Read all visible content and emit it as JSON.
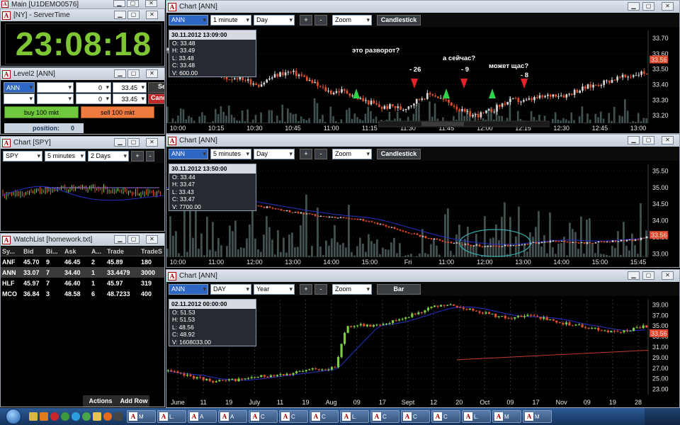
{
  "main": {
    "title": "Main [U1DEMO0576]"
  },
  "server_time": {
    "title": "[NY] - ServerTime",
    "time": "23:08:18"
  },
  "level2": {
    "title": "Level2 [ANN]",
    "symbol": "ANN",
    "row1": {
      "qty": "0",
      "price": "33.45",
      "side_btn": "Se"
    },
    "row2": {
      "qty": "0",
      "price": "33.45",
      "side_btn": "Canc"
    },
    "buy_label": "buy 100 mkt",
    "sell_label": "sell 100 mkt",
    "position_label": "position:",
    "position_value": "0"
  },
  "spy_chart": {
    "title": "Chart [SPY]",
    "symbol": "SPY",
    "interval": "5 minutes",
    "range": "2 Days",
    "plus": "+",
    "minus": "-"
  },
  "watchlist": {
    "title": "WatchList [homework.txt]",
    "columns": [
      "Sy...",
      "Bid",
      "Bi...",
      "Ask",
      "A...",
      "Trade",
      "TradeS"
    ],
    "rows": [
      [
        "ANF",
        "45.70",
        "9",
        "46.45",
        "2",
        "45.89",
        "180"
      ],
      [
        "ANN",
        "33.07",
        "7",
        "34.40",
        "1",
        "33.4479",
        "3000"
      ],
      [
        "HLF",
        "45.97",
        "7",
        "46.40",
        "1",
        "45.97",
        "319"
      ],
      [
        "MCO",
        "36.84",
        "3",
        "48.58",
        "6",
        "48.7233",
        "400"
      ]
    ],
    "actions_label": "Actions",
    "add_row_label": "Add Row"
  },
  "chart1": {
    "title": "Chart [ANN]",
    "symbol": "ANN",
    "interval": "1 minute",
    "range": "Day",
    "zoom": "Zoom",
    "style": "Candlestick",
    "plus": "+",
    "minus": "-",
    "ohlc": {
      "date": "30.11.2012 13:09:00",
      "o": "O: 33.48",
      "h": "H: 33.49",
      "l": "L: 33.48",
      "c": "C: 33.48",
      "v": "V: 600.00"
    },
    "last_price": "33.56",
    "annotations": [
      "это разворот?",
      "а сейчас?",
      "может щас?",
      "- 26",
      "- 9",
      "- 8"
    ]
  },
  "chart2": {
    "title": "Chart [ANN]",
    "symbol": "ANN",
    "interval": "5 minutes",
    "range": "Day",
    "zoom": "Zoom",
    "style": "Candlestick",
    "plus": "+",
    "minus": "-",
    "ohlc": {
      "date": "30.11.2012 13:50:00",
      "o": "O: 33.44",
      "h": "H: 33.47",
      "l": "L: 33.43",
      "c": "C: 33.47",
      "v": "V: 7700.00"
    },
    "last_price": "33.56"
  },
  "chart3": {
    "title": "Chart [ANN]",
    "symbol": "ANN",
    "interval": "DAY",
    "range": "Year",
    "zoom": "Zoom",
    "style": "Bar",
    "plus": "+",
    "minus": "-",
    "ohlc": {
      "date": "02.11.2012 00:00:00",
      "o": "O: 51.53",
      "h": "H: 51.53",
      "l": "L: 48.56",
      "c": "C: 48.92",
      "v": "V: 1608033.00"
    },
    "last_price": "33.56"
  },
  "chart_data": [
    {
      "type": "candlestick",
      "symbol": "ANN",
      "interval": "1 minute",
      "x_ticks": [
        "10:00",
        "10:15",
        "10:30",
        "10:45",
        "11:00",
        "11:15",
        "11:30",
        "11:45",
        "12:00",
        "12:15",
        "12:30",
        "12:45",
        "13:00"
      ],
      "y_ticks": [
        "33.70",
        "33.60",
        "33.50",
        "33.40",
        "33.30",
        "33.20"
      ],
      "ylim": [
        33.15,
        33.75
      ],
      "close": [
        33.62,
        33.58,
        33.55,
        33.52,
        33.5,
        33.46,
        33.44,
        33.45,
        33.42,
        33.4,
        33.44,
        33.47,
        33.48,
        33.46,
        33.42,
        33.38,
        33.35,
        33.36,
        33.34,
        33.3,
        33.28,
        33.25,
        33.26,
        33.24,
        33.28,
        33.32,
        33.34,
        33.3,
        33.27,
        33.22,
        33.2,
        33.21,
        33.24,
        33.28,
        33.3,
        33.29,
        33.31,
        33.32,
        33.34,
        33.33,
        33.36,
        33.38,
        33.4,
        33.42,
        33.44,
        33.45,
        33.47,
        33.48
      ]
    },
    {
      "type": "candlestick",
      "symbol": "ANN",
      "interval": "5 minutes",
      "x_ticks": [
        "10:00",
        "11:00",
        "12:00",
        "13:00",
        "14:00",
        "15:00",
        "Fri",
        "11:00",
        "12:00",
        "13:00",
        "14:00",
        "15:00",
        "15:45"
      ],
      "y_ticks": [
        "35.50",
        "35.00",
        "34.50",
        "34.00",
        "33.50",
        "33.00"
      ],
      "ylim": [
        32.9,
        35.7
      ],
      "close": [
        34.95,
        34.9,
        34.82,
        34.78,
        34.7,
        34.62,
        34.55,
        34.5,
        34.42,
        34.38,
        34.3,
        34.25,
        34.2,
        34.15,
        34.1,
        34.08,
        34.05,
        34.0,
        33.9,
        33.8,
        33.7,
        33.6,
        33.5,
        33.42,
        33.35,
        33.3,
        33.26,
        33.24,
        33.22,
        33.25,
        33.28,
        33.32,
        33.35,
        33.38,
        33.36,
        33.34,
        33.32,
        33.35,
        33.38,
        33.4,
        33.42,
        33.5
      ]
    },
    {
      "type": "bar",
      "symbol": "ANN",
      "interval": "DAY",
      "x_ticks": [
        "June",
        "11",
        "19",
        "July",
        "11",
        "19",
        "Aug",
        "09",
        "17",
        "Sept",
        "12",
        "20",
        "Oct",
        "09",
        "17",
        "Nov",
        "09",
        "19",
        "28"
      ],
      "y_ticks": [
        "39.00",
        "37.00",
        "35.00",
        "33.00",
        "31.00",
        "29.00",
        "27.00",
        "25.00",
        "23.00"
      ],
      "ylim": [
        22,
        40
      ],
      "close": [
        26.5,
        25.8,
        25.5,
        25.0,
        24.6,
        24.5,
        24.8,
        25.0,
        25.3,
        25.6,
        25.9,
        26.0,
        26.3,
        26.8,
        27.0,
        26.9,
        34.9,
        35.2,
        35.0,
        35.4,
        35.8,
        36.5,
        37.2,
        38.0,
        38.6,
        39.0,
        38.6,
        38.2,
        37.8,
        37.2,
        36.7,
        36.5,
        36.8,
        37.0,
        36.2,
        35.6,
        35.4,
        35.0,
        34.6,
        34.2,
        33.8,
        34.0,
        34.6,
        35.0
      ]
    }
  ]
}
